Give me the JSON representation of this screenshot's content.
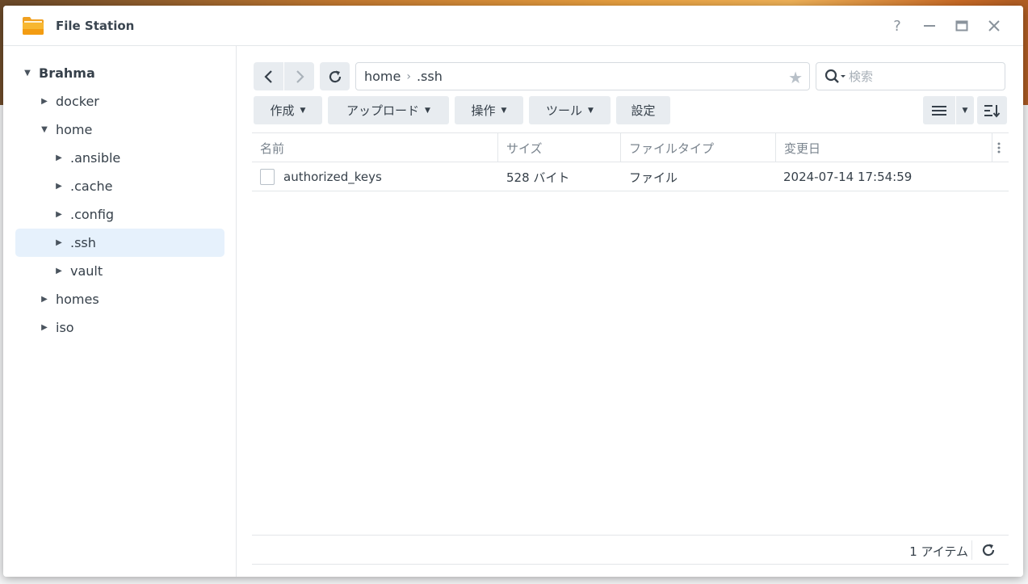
{
  "window": {
    "title": "File Station",
    "help_glyph": "?",
    "minimize_glyph": "—",
    "close_glyph": "✕"
  },
  "colors": {
    "accent": "#e6f1fc",
    "folder_icon": "#f5a623",
    "toolbar_button": "#e8ecf0"
  },
  "sidebar": {
    "root": "Brahma",
    "items": [
      {
        "label": "docker",
        "expanded": false
      },
      {
        "label": "home",
        "expanded": true
      },
      {
        "label": ".ansible",
        "expanded": false
      },
      {
        "label": ".cache",
        "expanded": false
      },
      {
        "label": ".config",
        "expanded": false
      },
      {
        "label": ".ssh",
        "expanded": false,
        "selected": true
      },
      {
        "label": "vault",
        "expanded": false
      },
      {
        "label": "homes",
        "expanded": false
      },
      {
        "label": "iso",
        "expanded": false
      }
    ]
  },
  "address": {
    "path": [
      "home",
      ".ssh"
    ],
    "separator": "›"
  },
  "search": {
    "placeholder": "検索"
  },
  "toolbar": {
    "create": "作成",
    "upload": "アップロード",
    "action": "操作",
    "tools": "ツール",
    "settings": "設定"
  },
  "table": {
    "columns": [
      "名前",
      "サイズ",
      "ファイルタイプ",
      "変更日"
    ],
    "rows": [
      {
        "name": "authorized_keys",
        "size": "528 バイト",
        "type": "ファイル",
        "modified": "2024-07-14 17:54:59"
      }
    ]
  },
  "footer": {
    "item_count": "1 アイテム"
  },
  "icons": {
    "back": "chevron-left-icon",
    "forward": "chevron-right-icon",
    "refresh": "refresh-icon",
    "star": "star-icon",
    "search": "search-icon",
    "list_view": "list-view-icon",
    "sort": "sort-icon",
    "more": "more-vertical-icon"
  }
}
